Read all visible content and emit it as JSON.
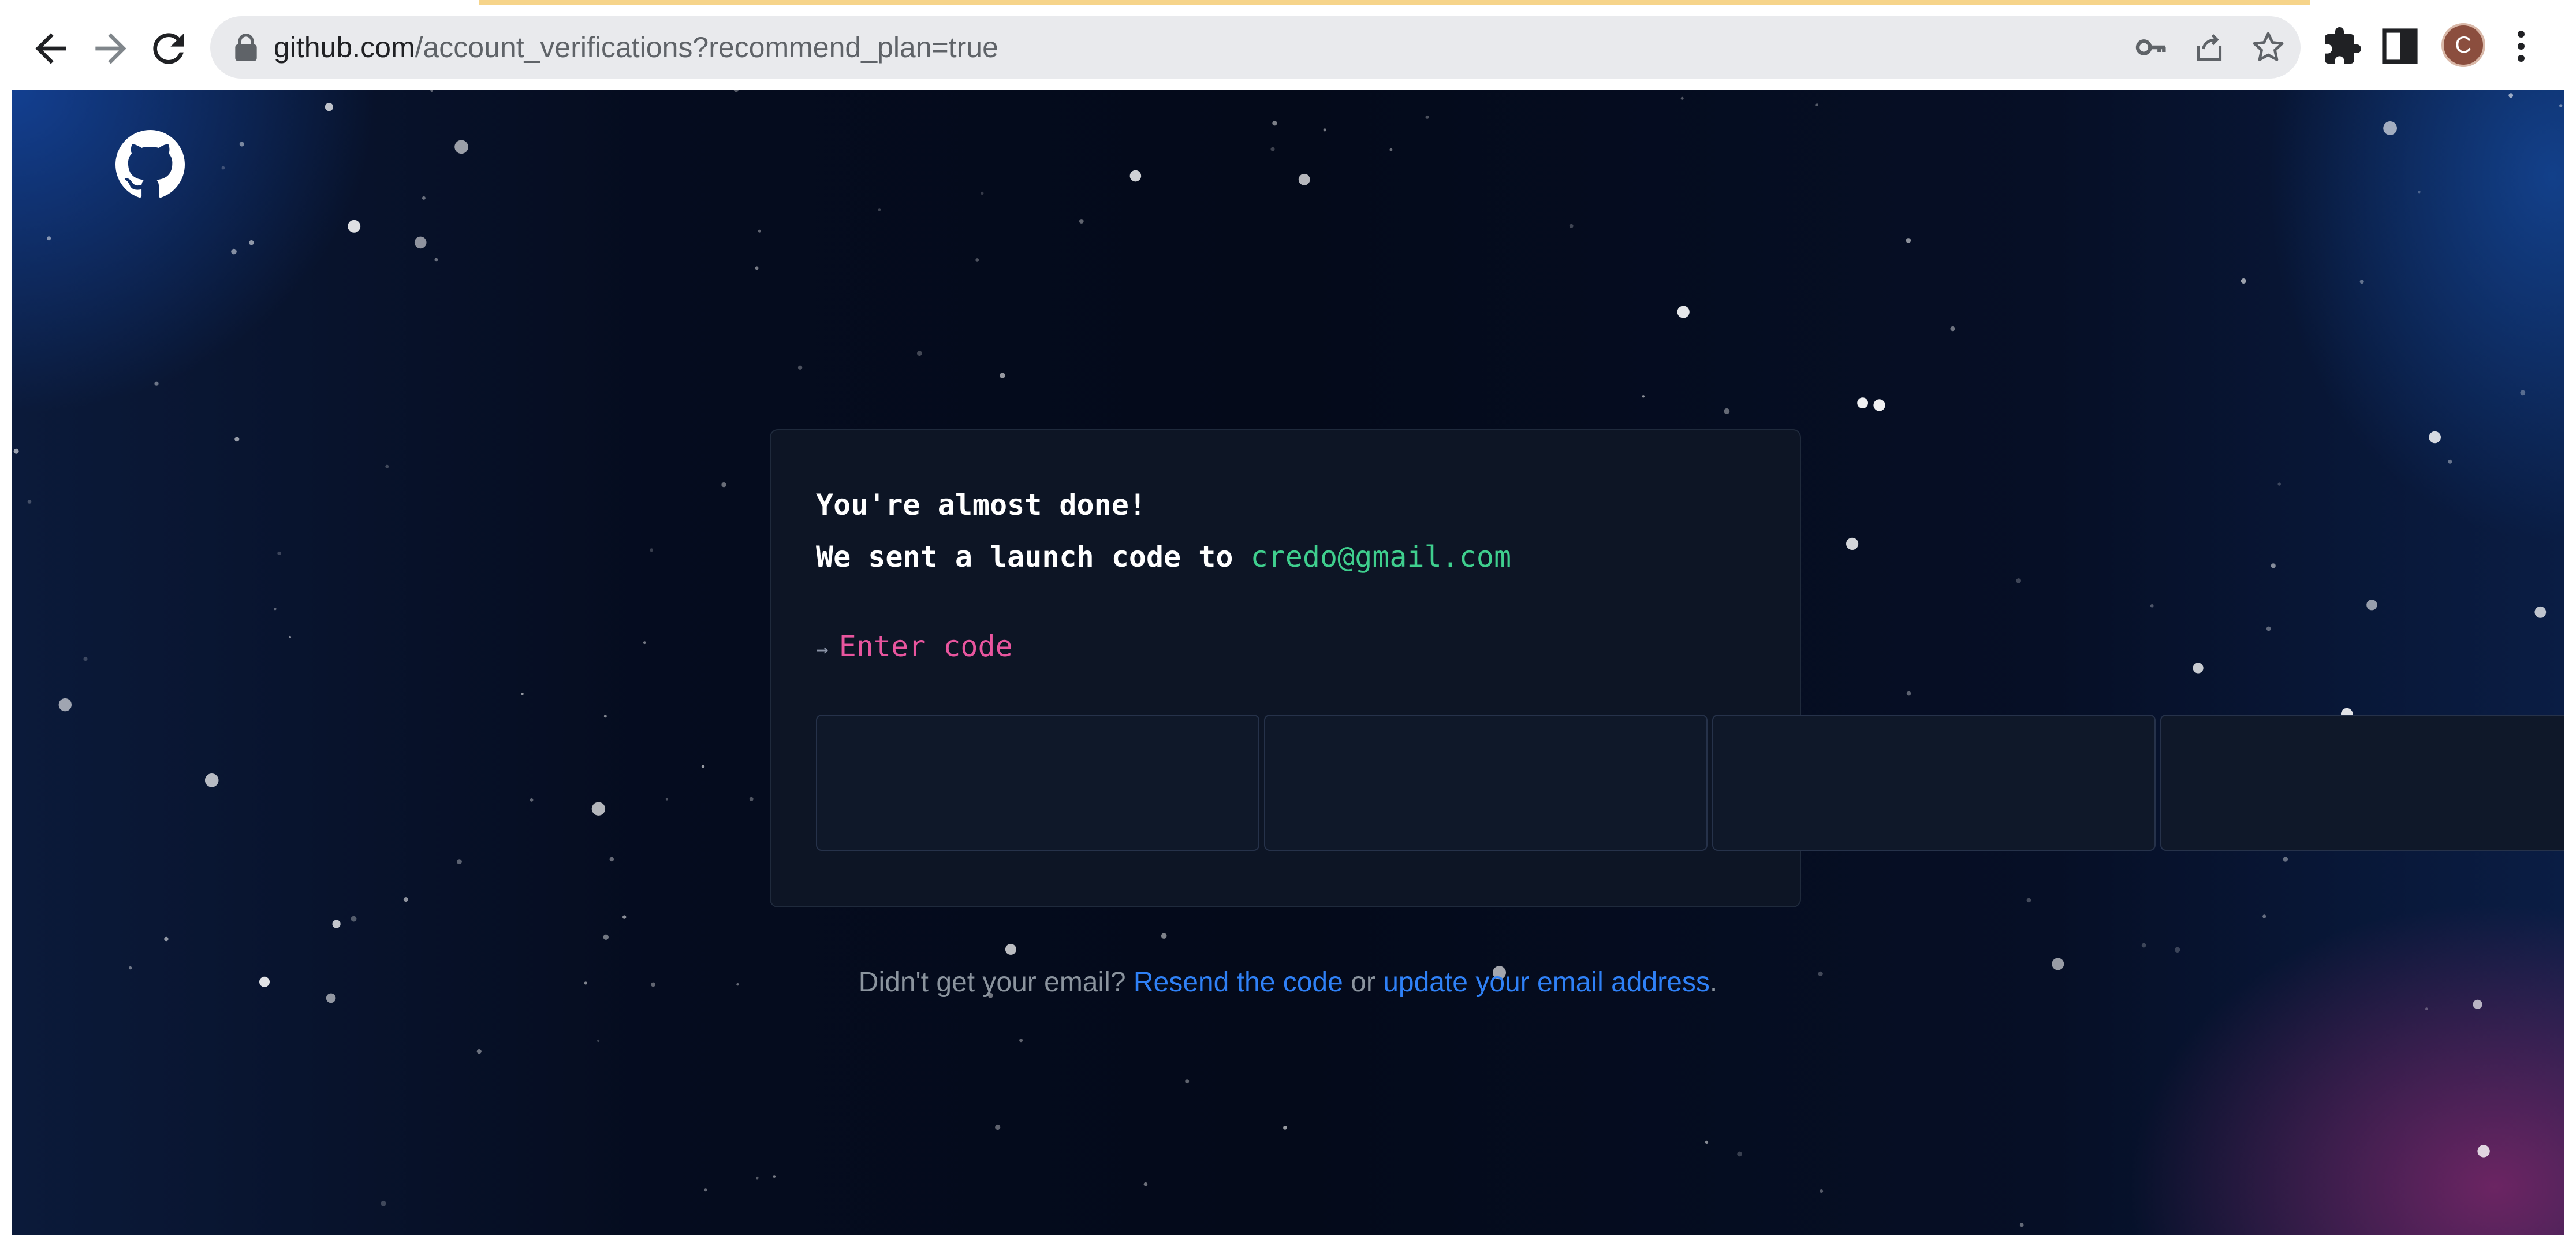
{
  "browser": {
    "url_host": "github.com",
    "url_path": "/account_verifications?recommend_plan=true",
    "avatar_initial": "C",
    "icons": [
      "back-arrow-icon",
      "forward-arrow-icon",
      "reload-icon",
      "lock-icon",
      "key-icon",
      "share-icon",
      "star-icon",
      "extensions-puzzle-icon",
      "side-panel-icon",
      "kebab-menu-icon"
    ]
  },
  "page": {
    "logo": "github-octocat-icon",
    "heading": "You're almost done!",
    "sent_text": "We sent a launch code to",
    "email": "credo@gmail.com",
    "enter_arrow": "→",
    "enter_label": "Enter code",
    "code_boxes": [
      "",
      "",
      "",
      "",
      "",
      "",
      "",
      ""
    ],
    "footer": {
      "prefix": "Didn't get your email?",
      "resend_link": "Resend the code",
      "or_text": "or",
      "update_link": "update your email address",
      "suffix": "."
    }
  },
  "colors": {
    "email": "#3fcf8e",
    "enter_label": "#e8559e",
    "link": "#2f81f7",
    "card_bg": "#0d1525"
  }
}
